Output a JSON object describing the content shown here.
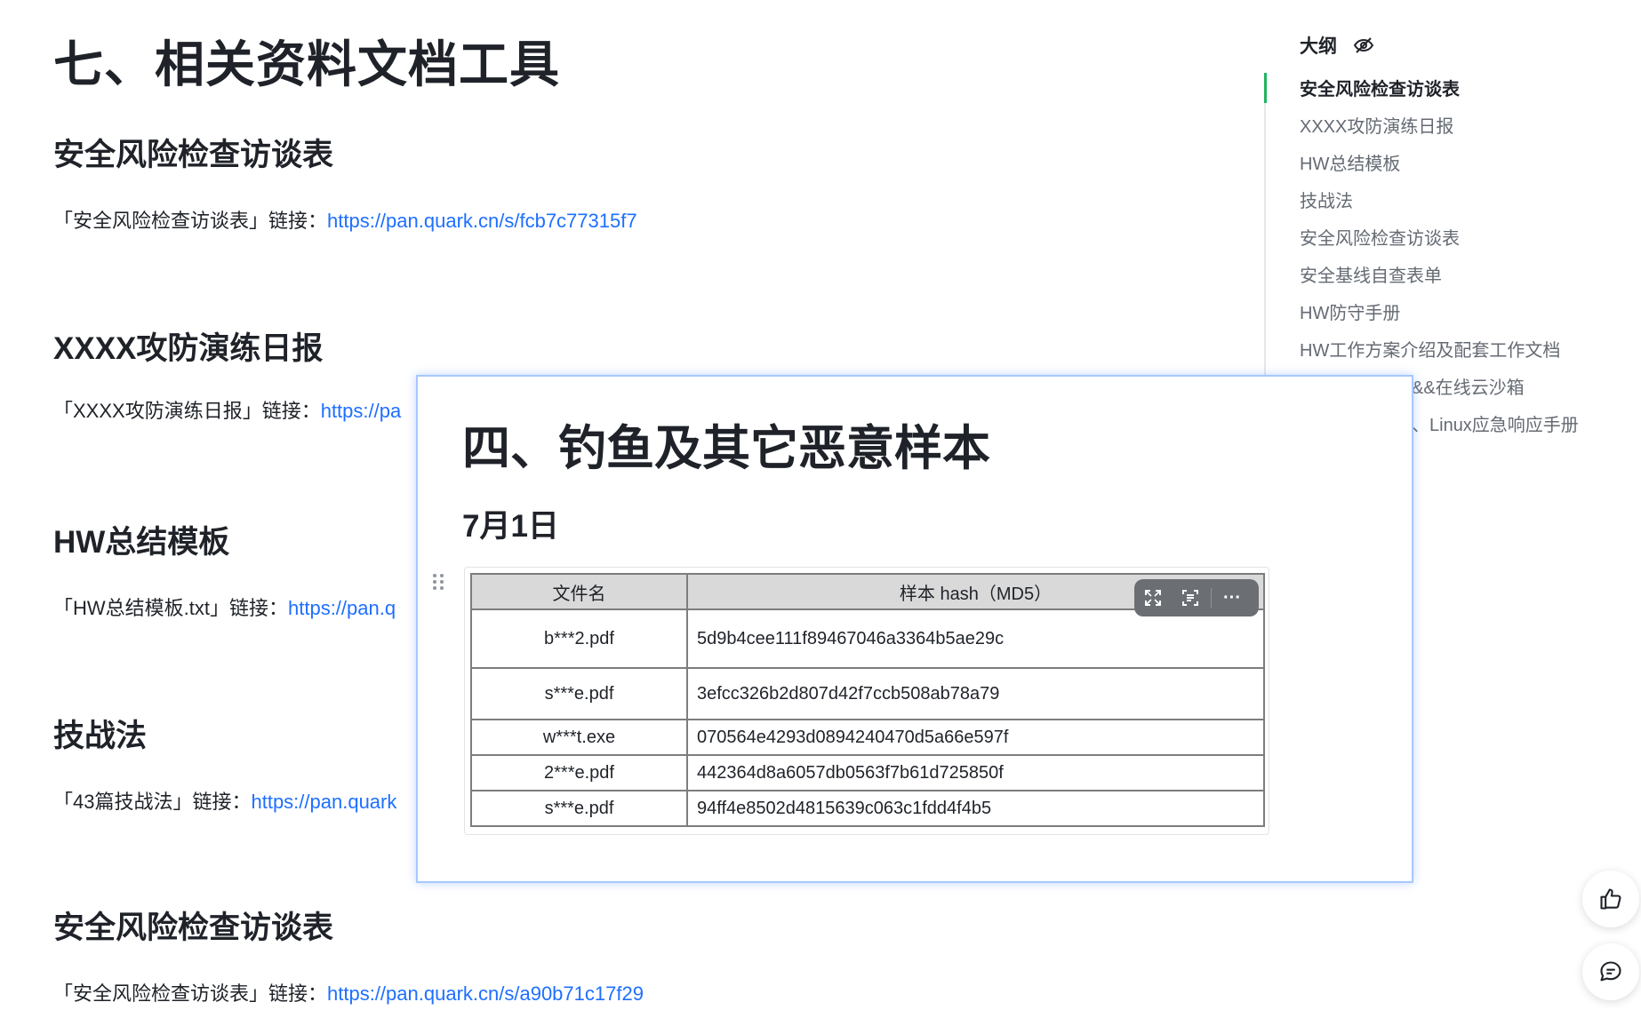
{
  "doc": {
    "title": "七、相关资料文档工具",
    "sections": [
      {
        "title": "安全风险检查访谈表",
        "text": "「安全风险检查访谈表」链接：",
        "link": "https://pan.quark.cn/s/fcb7c77315f7"
      },
      {
        "title": "XXXX攻防演练日报",
        "text": "「XXXX攻防演练日报」链接：",
        "link": "https://pa"
      },
      {
        "title": "HW总结模板",
        "text": "「HW总结模板.txt」链接：",
        "link": "https://pan.q"
      },
      {
        "title": "技战法",
        "text": "「43篇技战法」链接：",
        "link": "https://pan.quark"
      },
      {
        "title": "安全风险检查访谈表",
        "text": "「安全风险检查访谈表」链接：",
        "link": "https://pan.quark.cn/s/a90b71c17f29"
      }
    ]
  },
  "outline": {
    "title": "大纲",
    "hide_icon": "eye-off-icon",
    "items": [
      {
        "label": "安全风险检查访谈表",
        "active": true
      },
      {
        "label": "XXXX攻防演练日报"
      },
      {
        "label": "HW总结模板"
      },
      {
        "label": "技战法"
      },
      {
        "label": "安全风险检查访谈表"
      },
      {
        "label": "安全基线自查表单"
      },
      {
        "label": "HW防守手册"
      },
      {
        "label": "HW工作方案介绍及配套工作文档"
      },
      {
        "label": "&&在线云沙箱"
      },
      {
        "label": "、Linux应急响应手册"
      }
    ]
  },
  "preview": {
    "heading": "四、钓鱼及其它恶意样本",
    "subheading": "7月1日",
    "table": {
      "headers": [
        "文件名",
        "样本 hash（MD5）"
      ],
      "rows": [
        [
          "b***2.pdf",
          "5d9b4cee111f89467046a3364b5ae29c"
        ],
        [
          "s***e.pdf",
          "3efcc326b2d807d42f7ccb508ab78a79"
        ],
        [
          "w***t.exe",
          "070564e4293d0894240470d5a66e597f"
        ],
        [
          "2***e.pdf",
          "442364d8a6057db0563f7b61d725850f"
        ],
        [
          "s***e.pdf",
          "94ff4e8502d4815639c063c1fdd4f4b5"
        ]
      ]
    },
    "toolbar": {
      "expand_icon": "expand-icon",
      "ocr_icon": "scan-text-icon",
      "more_label": "···"
    }
  },
  "fab": {
    "like_icon": "thumbs-up-icon",
    "comment_icon": "comment-icon"
  },
  "colors": {
    "link": "#1e6fff",
    "outline_active": "#22b35e",
    "card_border": "#a6c8ff",
    "table_header_bg": "#d9d9d9"
  }
}
